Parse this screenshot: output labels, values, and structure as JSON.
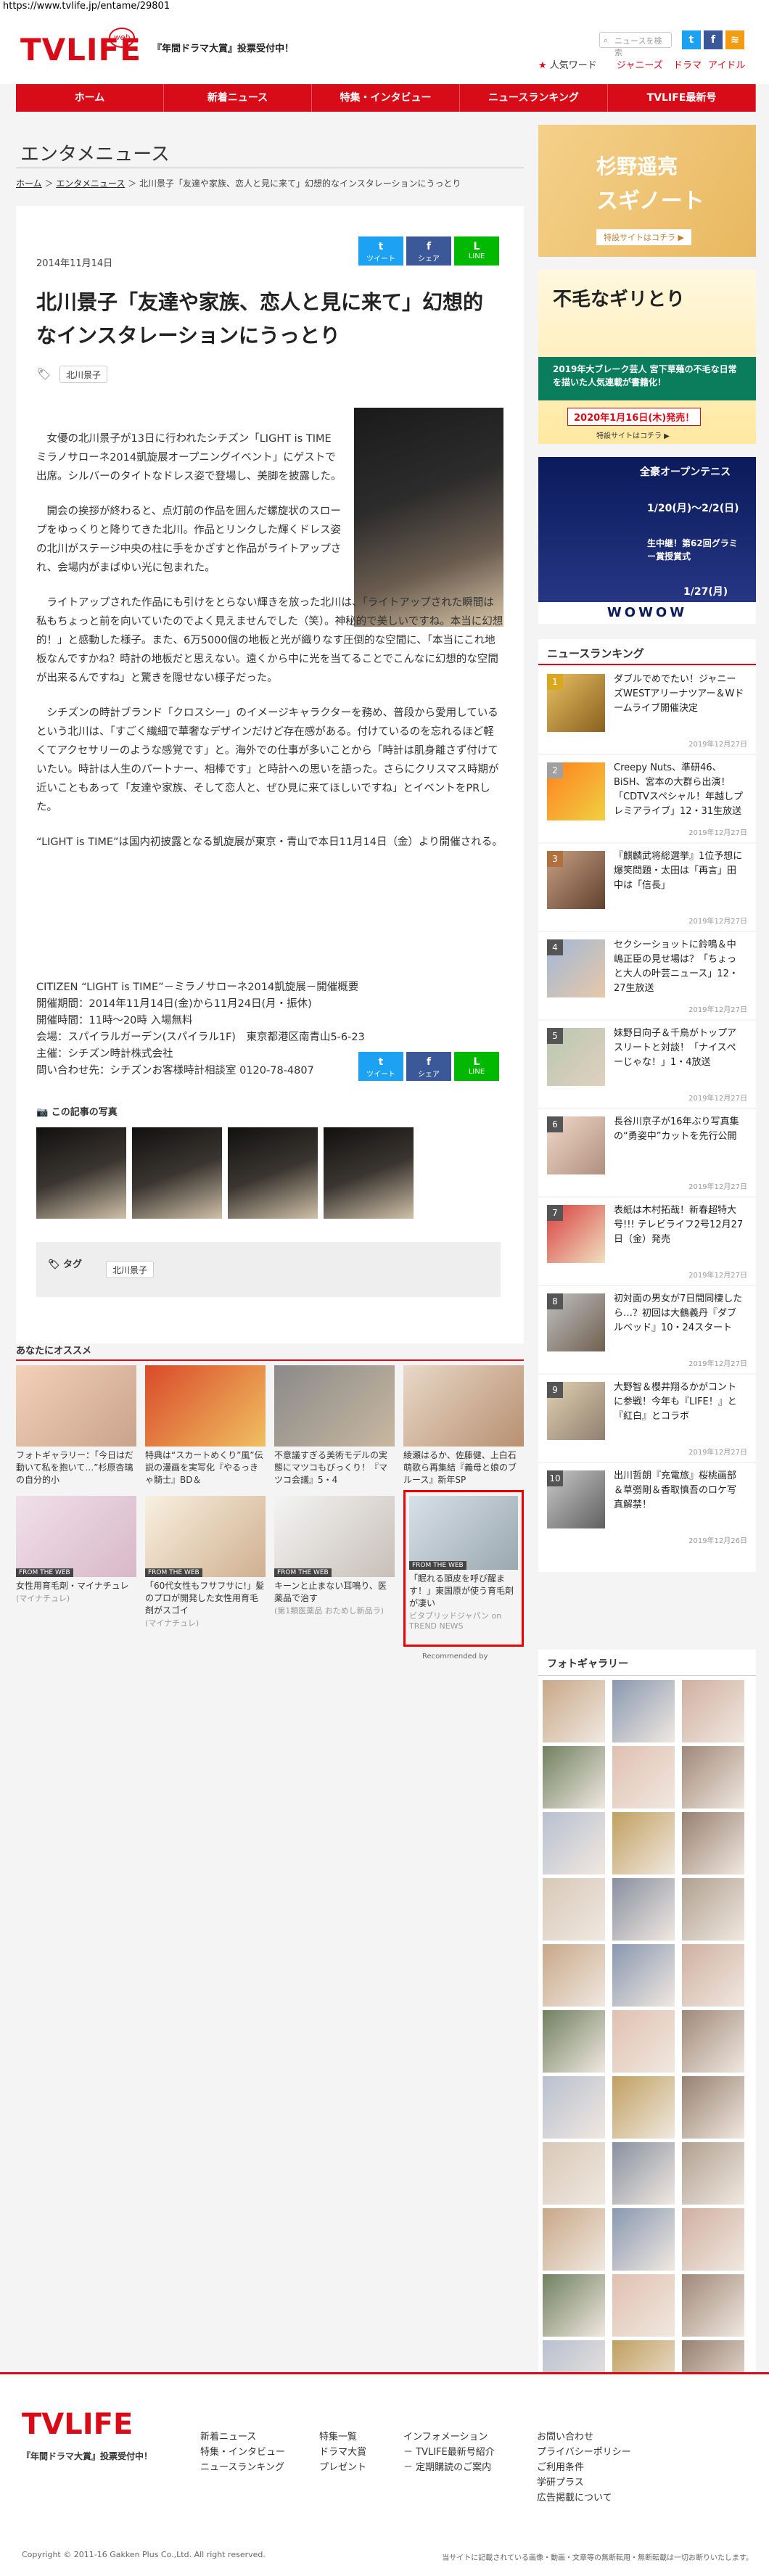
{
  "browser": {
    "url": "https://www.tvlife.jp/entame/29801"
  },
  "header": {
    "logo": "TVLIFE",
    "logo_sub": "web",
    "promo": "『年間ドラマ大賞』投票受付中！",
    "search_placeholder": "ニュースを検索",
    "hot_label": "人気ワード",
    "hot_words": [
      "ジャニーズ",
      "ドラマ",
      "アイドル"
    ],
    "sns": [
      "twitter",
      "facebook",
      "rss"
    ]
  },
  "nav": [
    "ホーム",
    "新着ニュース",
    "特集・インタビュー",
    "ニュースランキング",
    "TVLIFE最新号"
  ],
  "page": {
    "section_title": "エンタメニュース",
    "breadcrumb": [
      "ホーム",
      "エンタメニュース",
      "北川景子「友達や家族、恋人と見に来て」幻想的なインスタレーションにうっとり"
    ]
  },
  "article": {
    "date": "2014年11月14日",
    "share": [
      {
        "label": "ツイート",
        "icon": "t",
        "color": "#1da1f2"
      },
      {
        "label": "シェア",
        "icon": "f",
        "color": "#3b5998"
      },
      {
        "label": "LINE",
        "icon": "L",
        "color": "#00b900"
      }
    ],
    "title": "北川景子「友達や家族、恋人と見に来て」幻想的なインスタレーションにうっとり",
    "tag": "北川景子",
    "paragraphs": [
      "女優の北川景子が13日に行われたシチズン「LIGHT is TIME ミラノサローネ2014凱旋展オープニングイベント」にゲストで出席。シルバーのタイトなドレス姿で登場し、美脚を披露した。",
      "開会の挨拶が終わると、点灯前の作品を囲んだ螺旋状のスロープをゆっくりと降りてきた北川。作品とリンクした輝くドレス姿の北川がステージ中央の柱に手をかざすと作品がライトアップされ、会場内がまばゆい光に包まれた。",
      "ライトアップされた作品にも引けをとらない輝きを放った北川は、「ライトアップされた瞬間は私もちょっと前を向いていたのでよく見えませんでした（笑）。神秘的で美しいですね。本当に幻想的！」と感動した様子。また、6万5000個の地板と光が織りなす圧倒的な空間に、「本当にこれ地板なんですかね？時計の地板だと思えない。遠くから中に光を当てることでこんなに幻想的な空間が出来るんですね」と驚きを隠せない様子だった。",
      "シチズンの時計ブランド「クロスシー」のイメージキャラクターを務め、普段から愛用しているという北川は、「すごく繊細で華奢なデザインだけど存在感がある。付けているのを忘れるほど軽くてアクセサリーのような感覚です」と。海外での仕事が多いことから「時計は肌身離さず付けていたい。時計は人生のパートナー、相棒です」と時計への思いを語った。さらにクリスマス時期が近いこともあって「友達や家族、そして恋人と、ぜひ見に来てほしいですね」とイベントをPRした。",
      "“LIGHT is TIME”は国内初披露となる凱旋展が東京・青山で本日11月14日（金）より開催される。"
    ],
    "info": [
      "CITIZEN “LIGHT is TIME”－ミラノサローネ2014凱旋展－開催概要",
      "開催期間：2014年11月14日(金)から11月24日(月・振休)",
      "開催時間：11時〜20時 入場無料",
      "会場：スパイラルガーデン(スパイラル1F)　東京都港区南青山5-6-23",
      "主催：シチズン時計株式会社",
      "問い合わせ先：シチズンお客様時計相談室 0120-78-4807"
    ],
    "photos_label": "この記事の写真",
    "tag_label": "タグ"
  },
  "recommend": {
    "heading": "あなたにオススメ",
    "items": [
      {
        "caption": "フォトギャラリー：「今日はだ 動いて私を抱いて…”杉原杏璃の自分的小",
        "source": ""
      },
      {
        "caption": "特典は“スカートめくり”風”伝説の漫画を実写化『やるっきゃ騎士』BD＆",
        "source": ""
      },
      {
        "caption": "不意議すぎる美術モデルの実態にマツコもびっくり！『マツコ会議』5・4",
        "source": ""
      },
      {
        "caption": "綾瀬はるか、佐藤健、上白石萌歌ら再集結『義母と娘のブルース』新年SP",
        "source": ""
      },
      {
        "caption": "女性用育毛剤・マイナチュレ",
        "source": "(マイナチュレ)"
      },
      {
        "caption": "「60代女性もフサフサに!」髪のプロが開発した女性用育毛剤がスゴイ",
        "source": "(マイナチュレ)"
      },
      {
        "caption": "キーンと止まない耳鳴り、医薬品で治す",
        "source": "(第1類医薬品 おためし新品ラ)"
      },
      {
        "caption": "「眠れる頭皮を呼び醒ます！」東国原が使う育毛剤が凄い",
        "source": "ビタブリッドジャパン on TREND NEWS"
      }
    ],
    "from_web": "FROM THE WEB",
    "recommended_by": "Recommended by"
  },
  "sidebar": {
    "banner1": {
      "t1": "杉野遥亮",
      "t2": "スギノート",
      "sub": "特設サイトはコチラ ▶"
    },
    "banner2": {
      "t1": "不毛なギリとり",
      "t2": "2019年大ブレーク芸人 宮下草薙の不毛な日常を描いた人気連載が書籍化！",
      "t3": "2020年1月16日(木)発売！",
      "t4": "特設サイトはコチラ ▶"
    },
    "banner3": {
      "t1": "全豪オープンテニス",
      "t2": "1/20(月)～2/2(日)",
      "t3": "生中継！第62回グラミー賞授賞式",
      "t4": "1/27(月)",
      "t5": "WOWOW"
    },
    "ranking_heading": "ニュースランキング",
    "ranking": [
      {
        "n": "1",
        "text": "ダブルでめでたい！ジャニーズWESTアリーナツアー＆Wドームライブ開催決定",
        "date": "2019年12月27日"
      },
      {
        "n": "2",
        "text": "Creepy Nuts、準研46、BiSH、宮本の大群ら出演！「CDTVスペシャル！年越しプレミアライブ」12・31生放送",
        "date": "2019年12月27日"
      },
      {
        "n": "3",
        "text": "『麒麟武将総選挙』1位予想に爆笑問題・太田は「再言」田中は「信長」",
        "date": "2019年12月27日"
      },
      {
        "n": "4",
        "text": "セクシーショットに鈴鳴＆中嶋正臣の見せ場は？「ちょっと大人の叶芸ニュース」12・27生放送",
        "date": "2019年12月27日"
      },
      {
        "n": "5",
        "text": "妹野日向子＆千鳥がトップアスリートと対談！「ナイスぺーじゃな！」1・4放送",
        "date": "2019年12月27日"
      },
      {
        "n": "6",
        "text": "長谷川京子が16年ぶり写真集の“勇姿中”カットを先行公開",
        "date": "2019年12月27日"
      },
      {
        "n": "7",
        "text": "表紙は木村拓哉！新春超特大号!!! テレビライフ2号12月27日（金）発売",
        "date": "2019年12月27日"
      },
      {
        "n": "8",
        "text": "初対面の男女が7日間同棲したら…？初回は大鶴義丹『ダブルベッド』10・24スタート",
        "date": "2019年12月27日"
      },
      {
        "n": "9",
        "text": "大野智＆櫻井翔るかがコントに参戦！今年も『LIFE！』と『紅白』とコラボ",
        "date": "2019年12月27日"
      },
      {
        "n": "10",
        "text": "出川哲朗『充電旅』桜桃画部＆草彅剛＆香取慎吾のロケ写真解禁！",
        "date": "2019年12月26日"
      }
    ],
    "gallery_heading": "フォトギャラリー"
  },
  "footer": {
    "logo": "TVLIFE",
    "promo": "『年間ドラマ大賞』投票受付中！",
    "col1": [
      "新着ニュース",
      "特集・インタビュー",
      "ニュースランキング"
    ],
    "col2": [
      "特集一覧",
      "ドラマ大賞",
      "プレゼント"
    ],
    "col3": [
      "インフォメーション",
      "TVLIFE最新号紹介",
      "定期購読のご案内"
    ],
    "col4": [
      "お問い合わせ",
      "プライバシーポリシー",
      "ご利用条件",
      "学研プラス",
      "広告掲載について"
    ],
    "copyright": "Copyright © 2011-16 Gakken Plus Co.,Ltd. All right reserved.",
    "note": "当サイトに記載されている画像・動画・文章等の無断転用・無断転載は一切お断りいたします。"
  }
}
